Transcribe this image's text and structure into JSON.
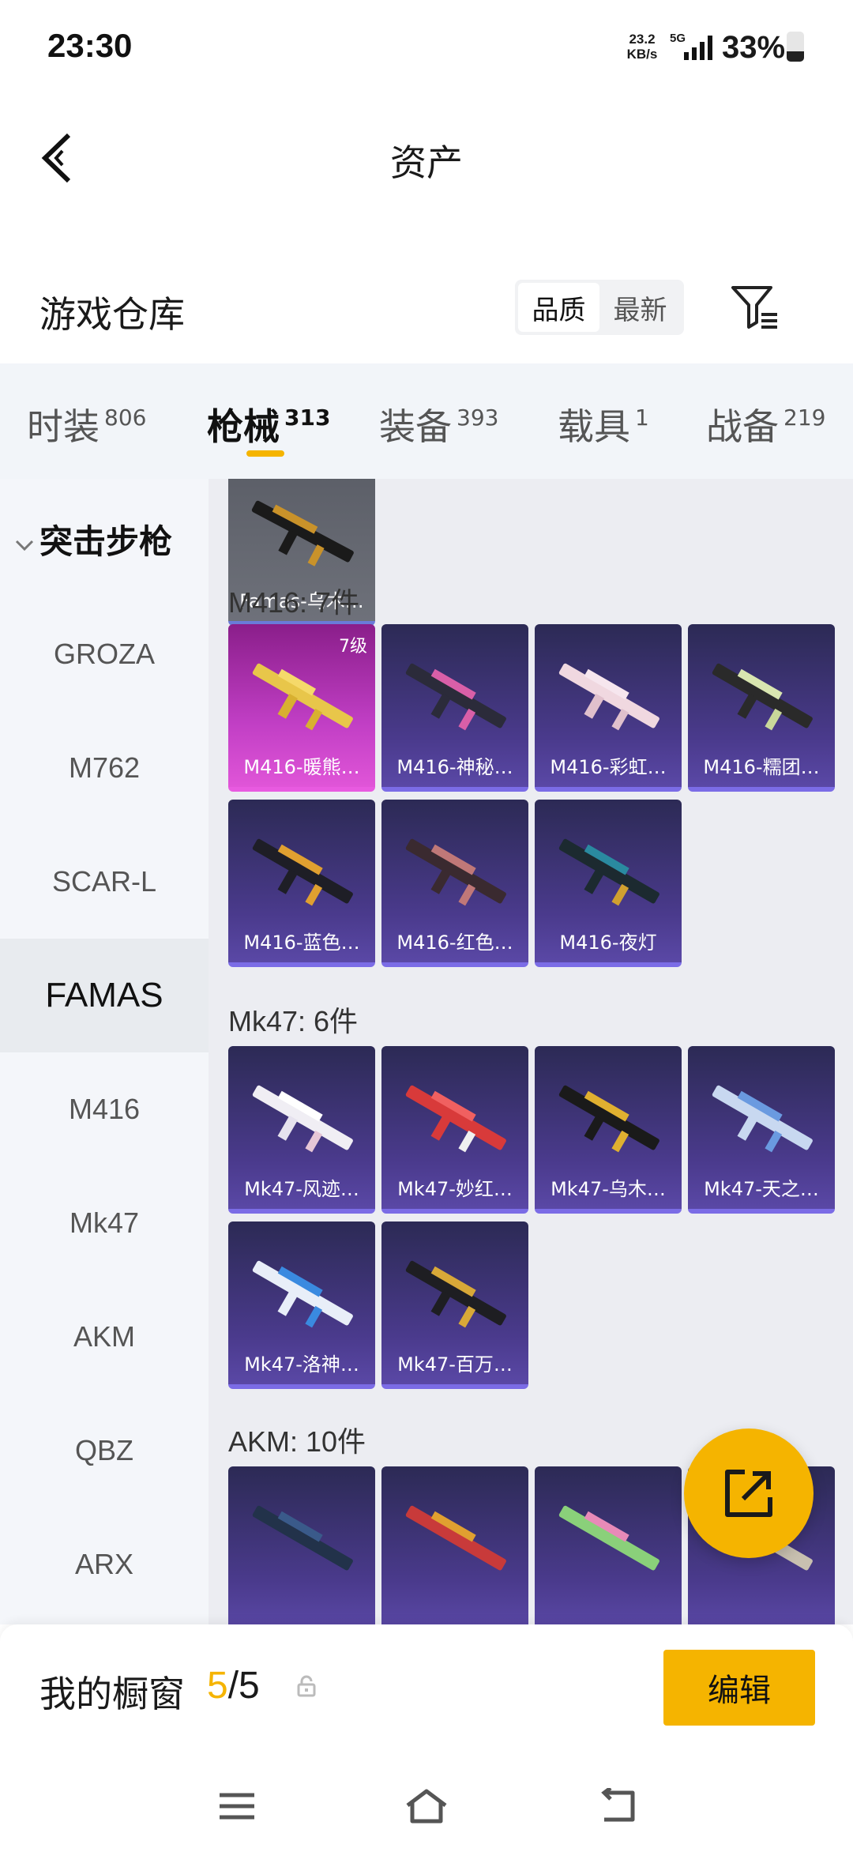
{
  "status_bar": {
    "time": "23:30",
    "net_speed": "23.2",
    "net_speed_unit": "KB/s",
    "network": "5G",
    "battery_text": "33%",
    "battery_level": 0.33
  },
  "header": {
    "title": "资产",
    "back_icon": "back-arrow-icon"
  },
  "warehouse": {
    "title": "游戏仓库",
    "sort_options": [
      "品质",
      "最新"
    ],
    "sort_selected": "品质",
    "filter_icon": "filter-icon"
  },
  "tabs": [
    {
      "label": "时装",
      "count": "806"
    },
    {
      "label": "枪械",
      "count": "313",
      "active": true
    },
    {
      "label": "装备",
      "count": "393"
    },
    {
      "label": "载具",
      "count": "1"
    },
    {
      "label": "战备",
      "count": "219"
    }
  ],
  "sidebar": {
    "group": "突击步枪",
    "items": [
      "GROZA",
      "M762",
      "SCAR-L",
      "FAMAS",
      "M416",
      "Mk47",
      "AKM",
      "QBZ",
      "ARX"
    ],
    "active": "FAMAS"
  },
  "sections": [
    {
      "title": "",
      "items": [
        {
          "label": "Famas-乌木…"
        }
      ]
    },
    {
      "title": "M416: 7件",
      "items": [
        {
          "label": "M416-暖熊…",
          "level": "7级"
        },
        {
          "label": "M416-神秘…"
        },
        {
          "label": "M416-彩虹…"
        },
        {
          "label": "M416-糯团…"
        },
        {
          "label": "M416-蓝色…"
        },
        {
          "label": "M416-红色…"
        },
        {
          "label": "M416-夜灯"
        }
      ]
    },
    {
      "title": "Mk47: 6件",
      "items": [
        {
          "label": "Mk47-风迹…"
        },
        {
          "label": "Mk47-妙红…"
        },
        {
          "label": "Mk47-乌木…"
        },
        {
          "label": "Mk47-天之…"
        },
        {
          "label": "Mk47-洛神…"
        },
        {
          "label": "Mk47-百万…"
        }
      ]
    },
    {
      "title": "AKM: 10件",
      "items": []
    }
  ],
  "fab_icon": "share-export-icon",
  "showcase": {
    "title": "我的橱窗",
    "current": "5",
    "total": "/5",
    "lock_icon": "lock-icon",
    "edit_label": "编辑"
  },
  "nav": {
    "menu_icon": "menu-icon",
    "home_icon": "home-icon",
    "back_icon": "back-icon"
  }
}
